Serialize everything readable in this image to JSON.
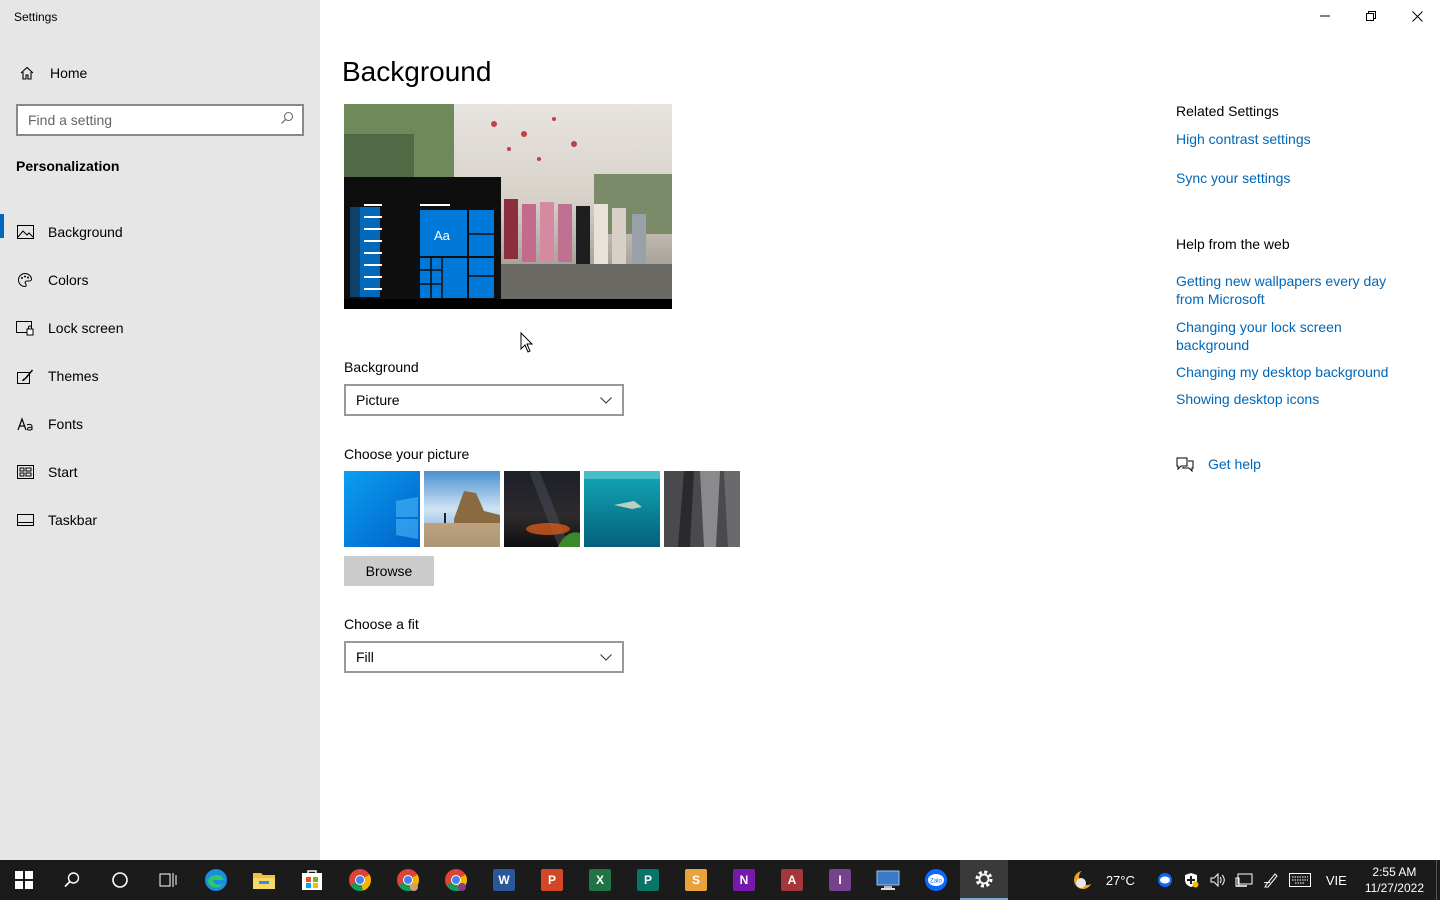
{
  "app": {
    "title": "Settings"
  },
  "sidebar": {
    "home_label": "Home",
    "search_placeholder": "Find a setting",
    "section_title": "Personalization",
    "items": [
      {
        "label": "Background",
        "icon": "image-icon"
      },
      {
        "label": "Colors",
        "icon": "palette-icon"
      },
      {
        "label": "Lock screen",
        "icon": "lock-screen-icon"
      },
      {
        "label": "Themes",
        "icon": "brush-icon"
      },
      {
        "label": "Fonts",
        "icon": "font-icon"
      },
      {
        "label": "Start",
        "icon": "start-menu-icon"
      },
      {
        "label": "Taskbar",
        "icon": "taskbar-icon"
      }
    ],
    "active_item": "Background"
  },
  "main": {
    "title": "Background",
    "preview": {
      "tile_text": "Aa"
    },
    "background_label": "Background",
    "background_value": "Picture",
    "choose_picture_label": "Choose your picture",
    "pictures": [
      "windows-blue",
      "beach-rocks",
      "night-sky",
      "underwater",
      "rock-cliff"
    ],
    "browse_label": "Browse",
    "fit_label": "Choose a fit",
    "fit_value": "Fill"
  },
  "related": {
    "heading": "Related Settings",
    "links": [
      "High contrast settings",
      "Sync your settings"
    ]
  },
  "help": {
    "heading": "Help from the web",
    "links": [
      "Getting new wallpapers every day from Microsoft",
      "Changing your lock screen background",
      "Changing my desktop background",
      "Showing desktop icons"
    ],
    "get_help": "Get help"
  },
  "taskbar": {
    "apps": [
      "start",
      "search",
      "cortana",
      "task-view",
      "edge",
      "file-explorer",
      "store",
      "chrome",
      "chrome",
      "chrome",
      "word",
      "powerpoint",
      "excel",
      "publisher",
      "slides",
      "onenote",
      "access",
      "infopath",
      "remote-desktop",
      "zalo",
      "settings"
    ],
    "app_letters": {
      "word": "W",
      "powerpoint": "P",
      "excel": "X",
      "publisher": "P",
      "slides": "S",
      "onenote": "N",
      "access": "A",
      "infopath": "I"
    },
    "app_colors": {
      "word": "#2b579a",
      "powerpoint": "#d24726",
      "excel": "#217346",
      "publisher": "#077568",
      "slides": "#e8a33d",
      "onenote": "#7719aa",
      "access": "#a4373a",
      "infopath": "#77428d"
    },
    "weather": "27°C",
    "language": "VIE",
    "time": "2:55 AM",
    "date": "11/27/2022"
  },
  "colors": {
    "accent": "#0067c0",
    "link": "#0067b8",
    "sidebar_bg": "#e6e6e6",
    "taskbar_bg": "#1b1b1b"
  }
}
